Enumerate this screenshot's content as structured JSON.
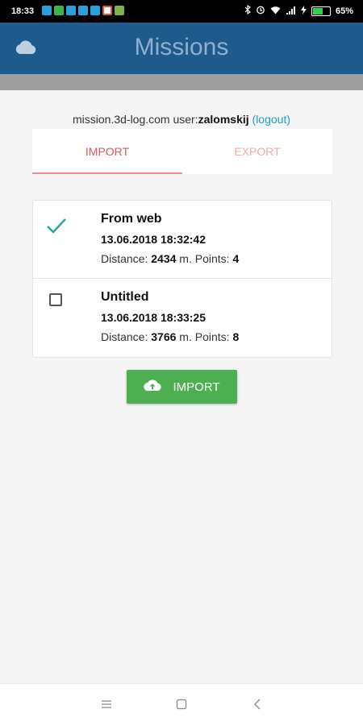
{
  "status_bar": {
    "time": "18:33",
    "battery_percent": "65%",
    "battery_level": 0.65,
    "notification_icons": [
      {
        "name": "notif-app-icon-1",
        "color": "#2b9fd9"
      },
      {
        "name": "notif-app-icon-2",
        "color": "#3bb54a"
      },
      {
        "name": "notif-app-icon-3",
        "color": "#2b9fd9"
      },
      {
        "name": "notif-app-icon-4",
        "color": "#2b9fd9"
      },
      {
        "name": "notif-app-icon-5",
        "color": "#2b9fd9"
      },
      {
        "name": "notif-app-icon-6",
        "color": "#e74c3c"
      },
      {
        "name": "notif-app-icon-7",
        "color": "#7cb342"
      }
    ],
    "system_icons": [
      "bluetooth-icon",
      "alarm-icon",
      "wifi-icon",
      "signal-icon",
      "charging-icon"
    ]
  },
  "app_bar": {
    "title": "Missions",
    "icon": "cloud-icon",
    "bg_color": "#1f5a8c"
  },
  "account": {
    "prefix": "mission.3d-log.com user:",
    "username": "zalomskij",
    "logout_label": "(logout)"
  },
  "tabs": [
    {
      "label": "IMPORT",
      "active": true
    },
    {
      "label": "EXPORT",
      "active": false
    }
  ],
  "missions": [
    {
      "name": "From web",
      "date": "13.06.2018 18:32:42",
      "distance_label": "Distance:",
      "distance": "2434",
      "unit_sep": "m. Points:",
      "points": "4",
      "selected": true
    },
    {
      "name": "Untitled",
      "date": "13.06.2018 18:33:25",
      "distance_label": "Distance:",
      "distance": "3766",
      "unit_sep": "m. Points:",
      "points": "8",
      "selected": false
    }
  ],
  "import_button": {
    "label": "IMPORT",
    "icon": "cloud-upload-icon",
    "color": "#4caf50"
  },
  "nav_bar": {
    "icons": [
      "menu-icon",
      "home-square-icon",
      "back-icon"
    ]
  }
}
